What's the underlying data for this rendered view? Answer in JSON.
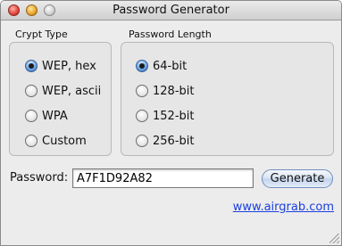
{
  "window": {
    "title": "Password Generator"
  },
  "crypt_type": {
    "label": "Crypt Type",
    "options": [
      "WEP, hex",
      "WEP, ascii",
      "WPA",
      "Custom"
    ],
    "selected": "WEP, hex"
  },
  "password_length": {
    "label": "Password Length",
    "options": [
      "64-bit",
      "128-bit",
      "152-bit",
      "256-bit"
    ],
    "selected": "64-bit"
  },
  "password": {
    "label": "Password:",
    "value": "A7F1D92A82"
  },
  "generate_button": {
    "label": "Generate"
  },
  "footer": {
    "link": "www.airgrab.com"
  }
}
